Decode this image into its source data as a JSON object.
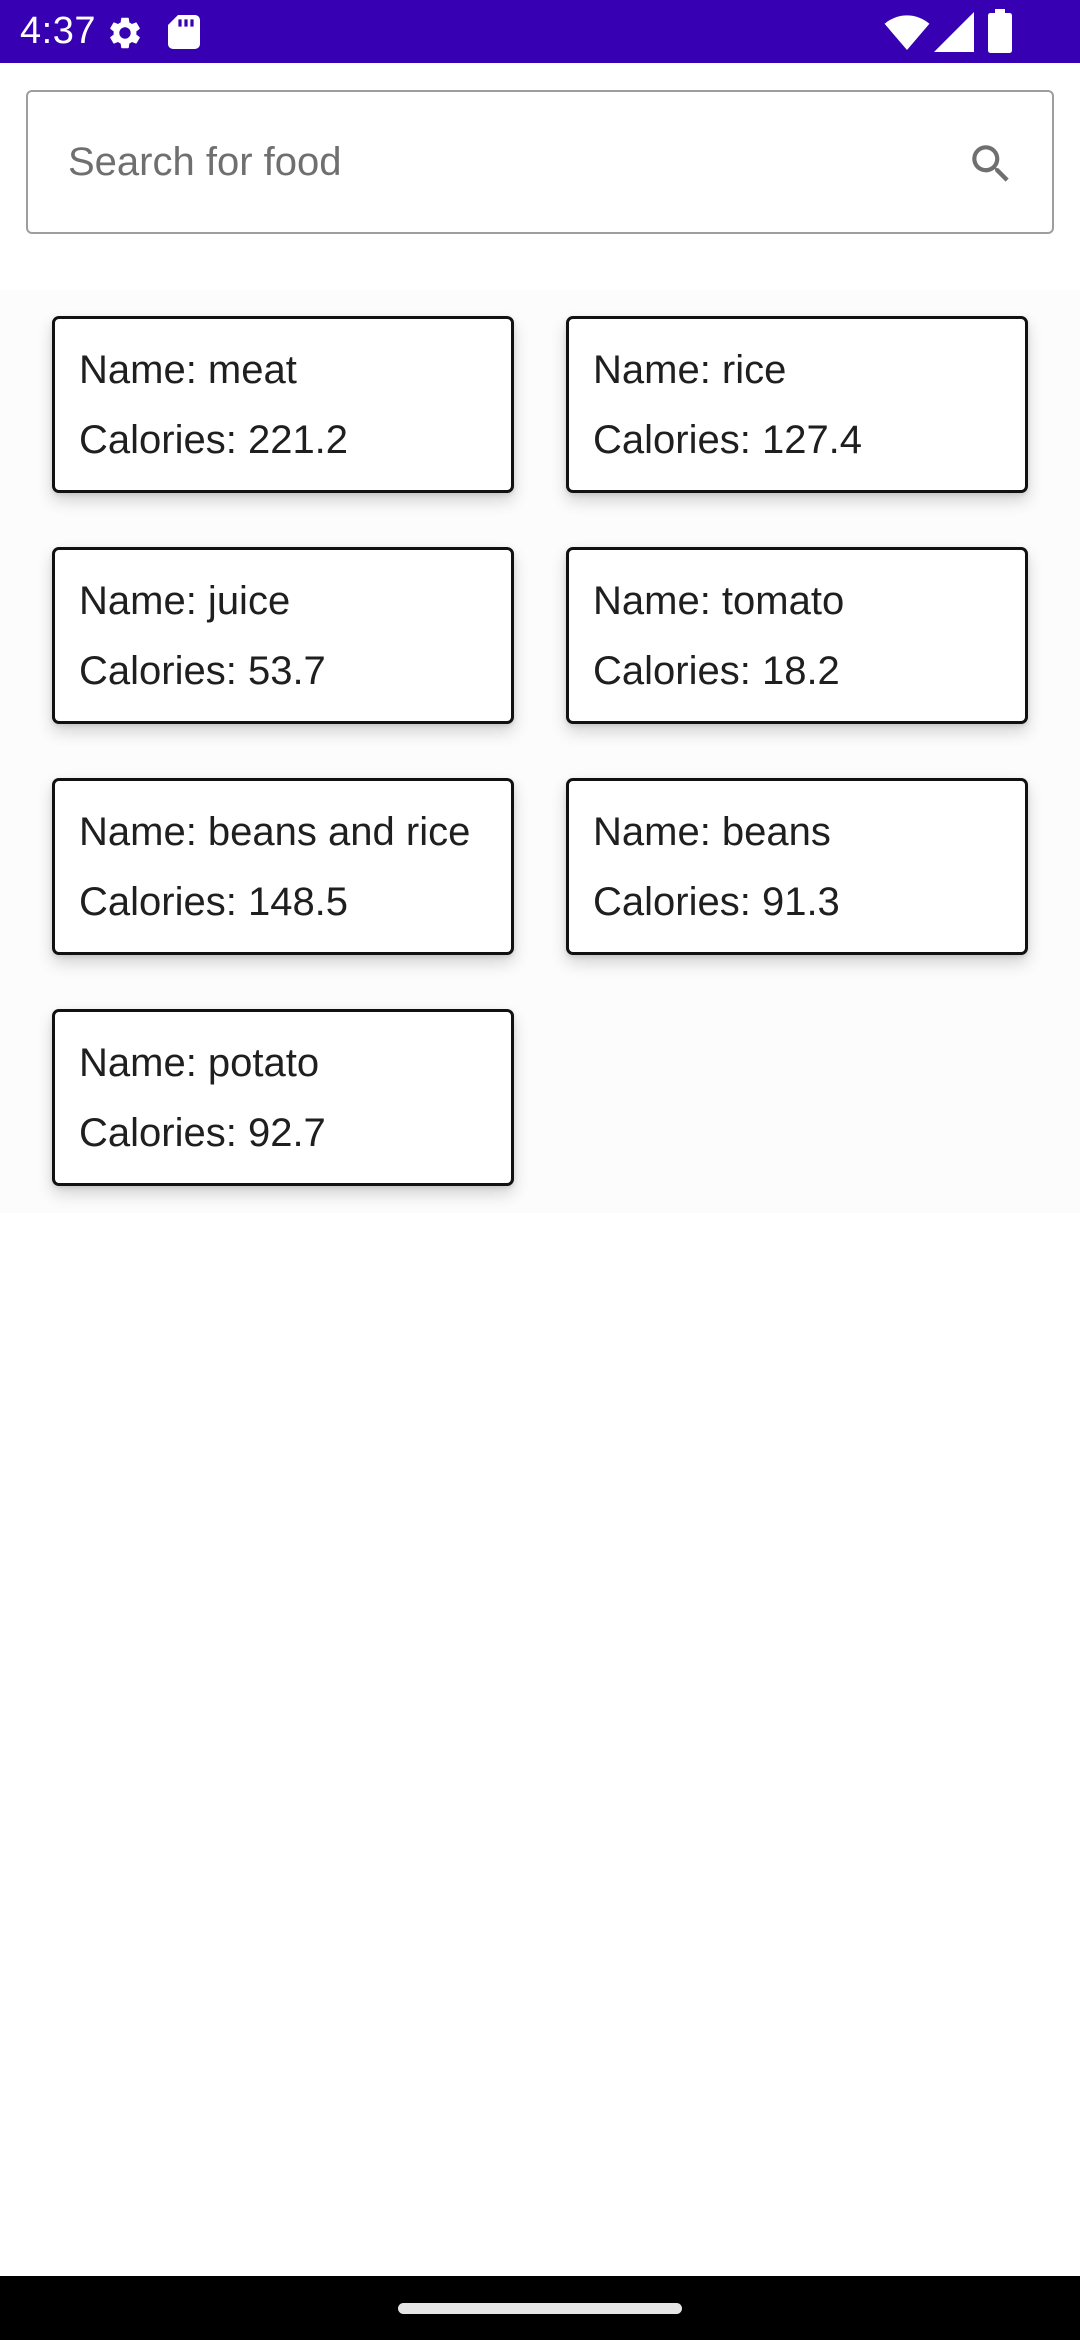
{
  "status_bar": {
    "time": "4:37",
    "background": "#3700b3",
    "icons_left": [
      "settings-gear-icon",
      "sd-card-icon"
    ],
    "icons_right": [
      "wifi-icon",
      "cell-signal-icon",
      "battery-icon"
    ]
  },
  "search": {
    "placeholder": "Search for food",
    "value": "",
    "icon": "search-icon"
  },
  "foods": [
    {
      "name_label": "Name: meat",
      "calories_label": "Calories: 221.2"
    },
    {
      "name_label": "Name: rice",
      "calories_label": "Calories: 127.4"
    },
    {
      "name_label": "Name: juice",
      "calories_label": "Calories: 53.7"
    },
    {
      "name_label": "Name: tomato",
      "calories_label": "Calories: 18.2"
    },
    {
      "name_label": "Name: beans and rice",
      "calories_label": "Calories: 148.5"
    },
    {
      "name_label": "Name: beans",
      "calories_label": "Calories: 91.3"
    },
    {
      "name_label": "Name: potato",
      "calories_label": "Calories: 92.7"
    }
  ],
  "nav_bar": {
    "handle": "gesture-handle"
  }
}
